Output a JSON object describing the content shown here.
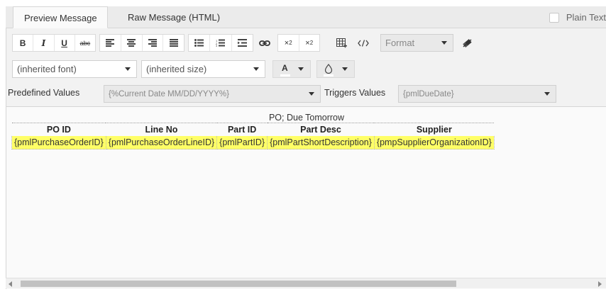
{
  "tabs": {
    "preview": "Preview Message",
    "raw": "Raw Message (HTML)"
  },
  "plain_text_label": "Plain Text",
  "toolbar": {
    "bold": "B",
    "italic": "I",
    "underline": "U",
    "strike": "abc",
    "format_label": "Format",
    "font_select": "(inherited font)",
    "size_select": "(inherited size)",
    "text_color_letter": "A"
  },
  "predefined": {
    "label": "Predefined Values",
    "value": "{%Current Date MM/DD/YYYY%}"
  },
  "triggers": {
    "label": "Triggers Values",
    "value": "{pmlDueDate}"
  },
  "message": {
    "caption": "PO; Due Tomorrow",
    "headers": [
      "PO ID",
      "Line No",
      "Part ID",
      "Part Desc",
      "Supplier"
    ],
    "row": [
      "{pmlPurchaseOrderID}",
      "{pmlPurchaseOrderLineID}",
      "{pmlPartID}",
      "{pmlPartShortDescription}",
      "{pmpSupplierOrganizationID}"
    ]
  },
  "colors": {
    "highlight": "#ffff66",
    "toolbar_bg": "#f2f2f2",
    "tab_bg": "#ebebeb"
  }
}
